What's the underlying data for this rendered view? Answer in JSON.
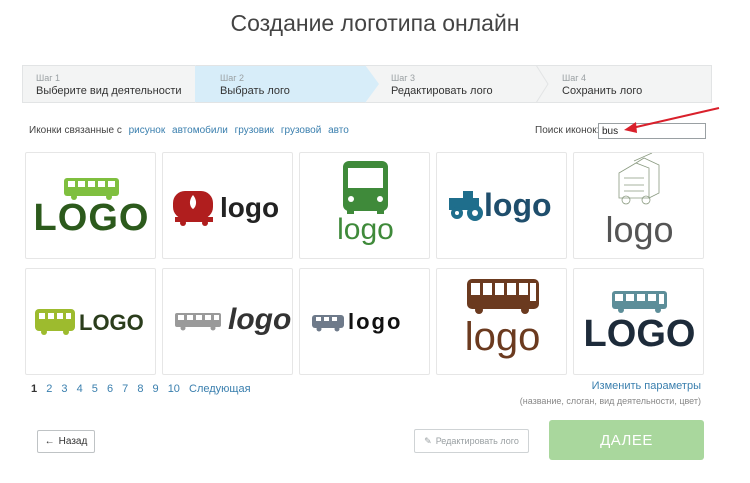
{
  "page_title": "Создание логотипа онлайн",
  "steps": [
    {
      "num": "Шаг 1",
      "label": "Выберите вид деятельности",
      "active": false
    },
    {
      "num": "Шаг 2",
      "label": "Выбрать лого",
      "active": true
    },
    {
      "num": "Шаг 3",
      "label": "Редактировать лого",
      "active": false
    },
    {
      "num": "Шаг 4",
      "label": "Сохранить лого",
      "active": false
    }
  ],
  "related": {
    "label": "Иконки связанные с",
    "tags": [
      "рисунок",
      "автомобили",
      "грузовик",
      "грузовой",
      "авто"
    ]
  },
  "search": {
    "label": "Поиск иконок:",
    "value": "bus"
  },
  "logos": [
    {
      "text": "LOGO",
      "icon": "bus-icon"
    },
    {
      "text": "logo",
      "icon": "tanker-truck-icon"
    },
    {
      "text": "logo",
      "icon": "bus-front-icon"
    },
    {
      "text": "logo",
      "icon": "tractor-icon"
    },
    {
      "text": "logo",
      "icon": "fire-engine-sketch-icon"
    },
    {
      "text": "LOGO",
      "icon": "minibus-icon"
    },
    {
      "text": "logo",
      "icon": "city-bus-icon"
    },
    {
      "text": "logo",
      "icon": "van-icon"
    },
    {
      "text": "logo",
      "icon": "double-bus-icon"
    },
    {
      "text": "LOGO",
      "icon": "coach-icon"
    }
  ],
  "pagination": {
    "pages": [
      "1",
      "2",
      "3",
      "4",
      "5",
      "6",
      "7",
      "8",
      "9",
      "10"
    ],
    "current": "1",
    "next_label": "Следующая"
  },
  "change_params": {
    "link": "Изменить параметры",
    "hint": "(название, слоган, вид деятельности, цвет)"
  },
  "buttons": {
    "back": "Назад",
    "edit": "Редактировать лого",
    "next": "ДАЛЕЕ"
  },
  "colors": {
    "accent_green": "#a9d79d",
    "active_step": "#d7edf9",
    "link": "#3a7fae",
    "annotation_arrow": "#d9202b"
  }
}
